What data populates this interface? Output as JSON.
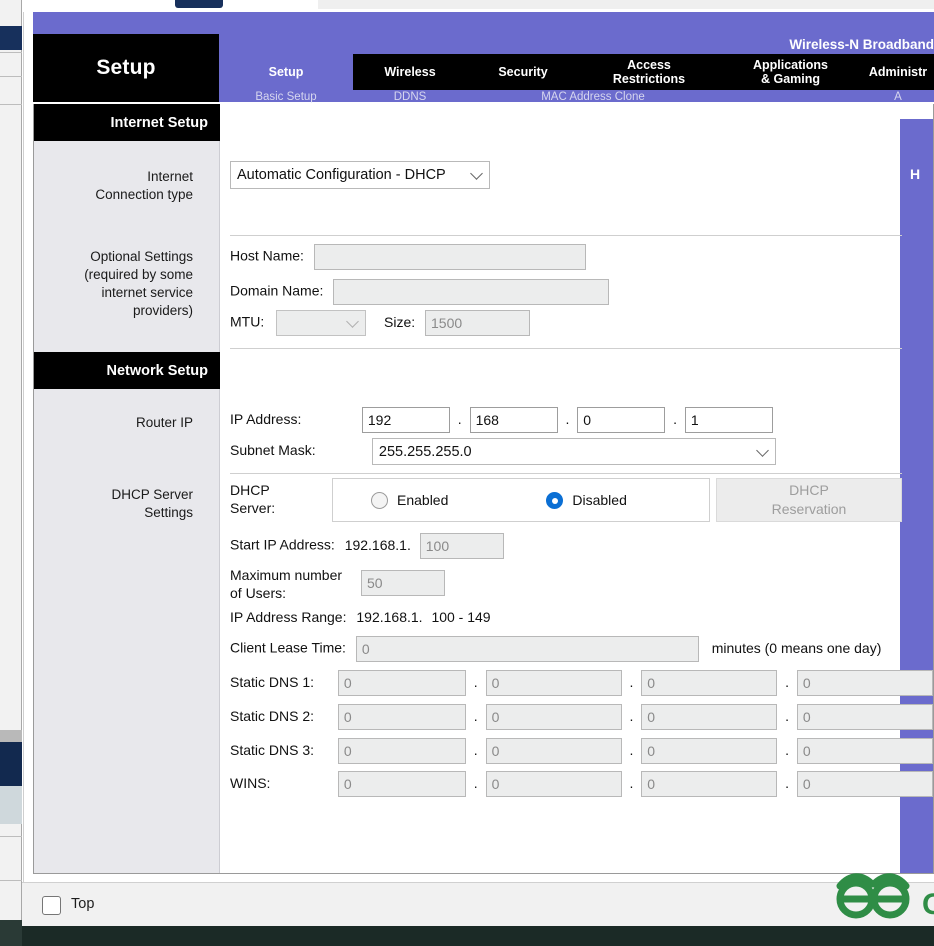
{
  "banner": {
    "brand_title": "Setup",
    "product_name": "Wireless-N Broadband"
  },
  "nav": {
    "items": [
      {
        "label": "Setup",
        "sub": "Basic Setup",
        "active": true
      },
      {
        "label": "Wireless",
        "sub": "DDNS",
        "active": false
      },
      {
        "label": "Security",
        "sub": "MAC Address Clone",
        "active": false
      },
      {
        "label": "Access\nRestrictions",
        "line1": "Access",
        "line2": "Restrictions",
        "sub": "A",
        "active": false
      },
      {
        "label": "Applications\n& Gaming",
        "line1": "Applications",
        "line2": "& Gaming",
        "sub": "",
        "active": false
      },
      {
        "label": "Administr",
        "sub": "A",
        "active": false
      }
    ],
    "labels": {
      "setup": "Setup",
      "wireless": "Wireless",
      "security": "Security",
      "access_l1": "Access",
      "access_l2": "Restrictions",
      "apps_l1": "Applications",
      "apps_l2": "& Gaming",
      "admin": "Administr"
    },
    "sublabels": {
      "basic_setup": "Basic Setup",
      "ddns": "DDNS",
      "mac_clone": "MAC Address Clone",
      "admin_sub": "A"
    }
  },
  "help_rail": {
    "letter": "H"
  },
  "sections": {
    "internet_setup": {
      "title": "Internet Setup",
      "connection_type_label_l1": "Internet",
      "connection_type_label_l2": "Connection type",
      "connection_type_value": "Automatic Configuration - DHCP",
      "optional_label_l1": "Optional Settings",
      "optional_label_l2": "(required by some",
      "optional_label_l3": "internet service",
      "optional_label_l4": "providers)",
      "host_name_label": "Host Name:",
      "host_name_value": "",
      "domain_name_label": "Domain Name:",
      "domain_name_value": "",
      "mtu_label": "MTU:",
      "mtu_value": "",
      "size_label": "Size:",
      "size_value": "1500"
    },
    "network_setup": {
      "title": "Network Setup",
      "router_ip_label": "Router IP",
      "ip_address_label": "IP Address:",
      "ip_octets": [
        "192",
        "168",
        "0",
        "1"
      ],
      "dot": ".",
      "subnet_mask_label": "Subnet Mask:",
      "subnet_mask_value": "255.255.255.0",
      "dhcp_settings_label_l1": "DHCP Server",
      "dhcp_settings_label_l2": "Settings",
      "dhcp_server_label_l1": "DHCP",
      "dhcp_server_label_l2": "Server:",
      "radio_enabled": "Enabled",
      "radio_disabled": "Disabled",
      "radio_selected": "Disabled",
      "dhcp_reservation_l1": "DHCP",
      "dhcp_reservation_l2": "Reservation",
      "start_ip_label": "Start IP Address:",
      "start_ip_prefix": "192.168.1.",
      "start_ip_value": "100",
      "max_users_label_l1": "Maximum number",
      "max_users_label_l2": "of Users:",
      "max_users_value": "50",
      "ip_range_label": "IP Address Range:",
      "ip_range_prefix": "192.168.1.",
      "ip_range_value": "100  -  149",
      "lease_time_label": "Client Lease Time:",
      "lease_time_value": "0",
      "lease_time_suffix": "minutes (0 means one day)",
      "dns_rows": [
        {
          "label": "Static DNS 1:",
          "octets": [
            "0",
            "0",
            "0",
            "0"
          ]
        },
        {
          "label": "Static DNS 2:",
          "octets": [
            "0",
            "0",
            "0",
            "0"
          ]
        },
        {
          "label": "Static DNS 3:",
          "octets": [
            "0",
            "0",
            "0",
            "0"
          ]
        },
        {
          "label": "WINS:",
          "octets": [
            "0",
            "0",
            "0",
            "0"
          ]
        }
      ]
    }
  },
  "statusbar": {
    "top_checkbox_label": "Top",
    "logo_alt": "geeksforgeeks-logo"
  },
  "colors": {
    "purple": "#6b6bcd",
    "black": "#000000",
    "label_grey": "#e8e8ec",
    "radio_blue": "#0b6fd4",
    "logo_green": "#2f8d46"
  }
}
